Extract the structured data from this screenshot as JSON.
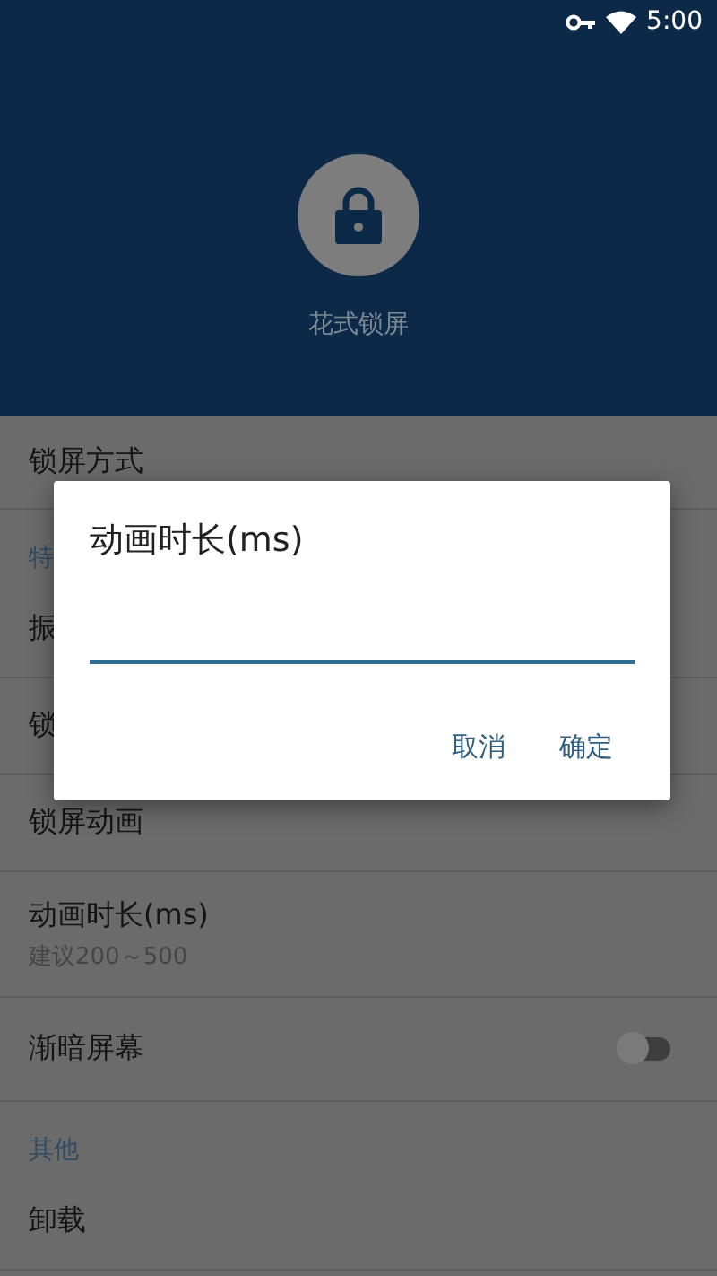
{
  "status_bar": {
    "time": "5:00"
  },
  "header": {
    "title": "花式锁屏"
  },
  "settings": [
    {
      "kind": "row",
      "title": "锁屏方式"
    },
    {
      "kind": "section",
      "title": "特"
    },
    {
      "kind": "row",
      "title": "振"
    },
    {
      "kind": "row",
      "title": "锁"
    },
    {
      "kind": "row",
      "title": "锁屏动画"
    },
    {
      "kind": "row",
      "title": "动画时长(ms)",
      "subtitle": "建议200～500"
    },
    {
      "kind": "toggle",
      "title": "渐暗屏幕",
      "on": false
    },
    {
      "kind": "section",
      "title": "其他"
    },
    {
      "kind": "row",
      "title": "卸载"
    }
  ],
  "dialog": {
    "title": "动画时长(ms)",
    "buttons": [
      "取消",
      "确定"
    ]
  }
}
